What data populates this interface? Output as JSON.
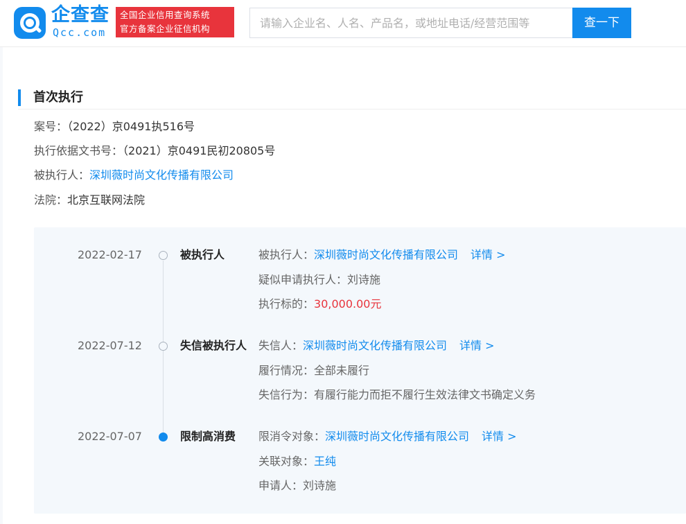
{
  "header": {
    "brand_cn": "企查查",
    "brand_en": "Qcc.com",
    "badge_line1": "全国企业信用查询系统",
    "badge_line2": "官方备案企业征信机构",
    "search_placeholder": "请输入企业名、人名、产品名，或地址电话/经营范围等",
    "search_button": "查一下"
  },
  "section": {
    "title": "首次执行",
    "fields": [
      {
        "label": "案号：",
        "value": "（2022）京0491执516号"
      },
      {
        "label": "执行依据文书号：",
        "value": "（2021）京0491民初20805号"
      },
      {
        "label": "被执行人：",
        "value": "深圳薇时尚文化传播有限公司"
      },
      {
        "label": "法院：",
        "value": "北京互联网法院"
      }
    ]
  },
  "timeline": [
    {
      "date": "2022-02-17",
      "type": "被执行人",
      "lines": [
        {
          "label": "被执行人：",
          "value": "深圳薇时尚文化传播有限公司",
          "detail": "详情 >"
        },
        {
          "label": "疑似申请执行人：",
          "value": "刘诗施"
        },
        {
          "label": "执行标的：",
          "value": "30,000.00元"
        }
      ]
    },
    {
      "date": "2022-07-12",
      "type": "失信被执行人",
      "lines": [
        {
          "label": "失信人：",
          "value": "深圳薇时尚文化传播有限公司",
          "detail": "详情 >"
        },
        {
          "label": "履行情况：",
          "value": "全部未履行"
        },
        {
          "label": "失信行为：",
          "value": "有履行能力而拒不履行生效法律文书确定义务"
        }
      ]
    },
    {
      "date": "2022-07-07",
      "type": "限制高消费",
      "lines": [
        {
          "label": "限消令对象：",
          "value": "深圳薇时尚文化传播有限公司",
          "detail": "详情 >"
        },
        {
          "label": "关联对象：",
          "value": "王纯"
        },
        {
          "label": "申请人：",
          "value": "刘诗施"
        }
      ]
    }
  ],
  "colors": {
    "brand_blue": "#128bed",
    "badge_red": "#e8343c",
    "amount_red": "#e8343c",
    "panel_bg": "#f4f8fc"
  }
}
